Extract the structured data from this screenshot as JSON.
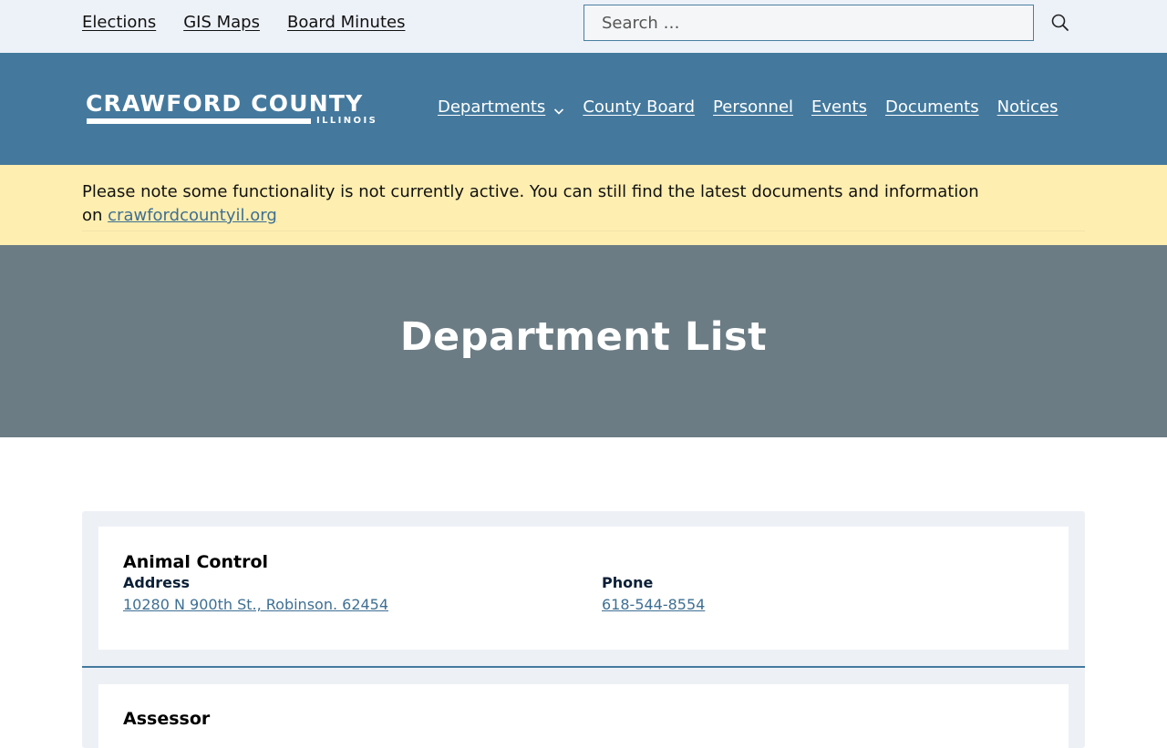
{
  "utility": {
    "links": [
      "Elections",
      "GIS Maps",
      "Board Minutes"
    ],
    "search_placeholder": "Search …",
    "search_icon": "search-icon"
  },
  "header": {
    "logo_name": "CRAWFORD COUNTY",
    "logo_state": "ILLINOIS",
    "nav": [
      "Departments",
      "County Board",
      "Personnel",
      "Events",
      "Documents",
      "Notices"
    ],
    "dropdown_icon": "chevron-down-icon"
  },
  "notice": {
    "text": "Please note some functionality is not currently active. You can still find the latest documents and information on",
    "link": "crawfordcountyil.org"
  },
  "hero": {
    "title": "Department List"
  },
  "departments": [
    {
      "name": "Animal Control",
      "address_label": "Address",
      "address": "10280 N 900th St., Robinson. 62454",
      "phone_label": "Phone",
      "phone": "618-544-8554"
    },
    {
      "name": "Assessor"
    }
  ],
  "colors": {
    "utility_bg": "#edf1f8",
    "header_bg": "#44799d",
    "notice_bg": "#feeeb0",
    "hero_bg": "#6c7c84",
    "link": "#3e6f93"
  }
}
